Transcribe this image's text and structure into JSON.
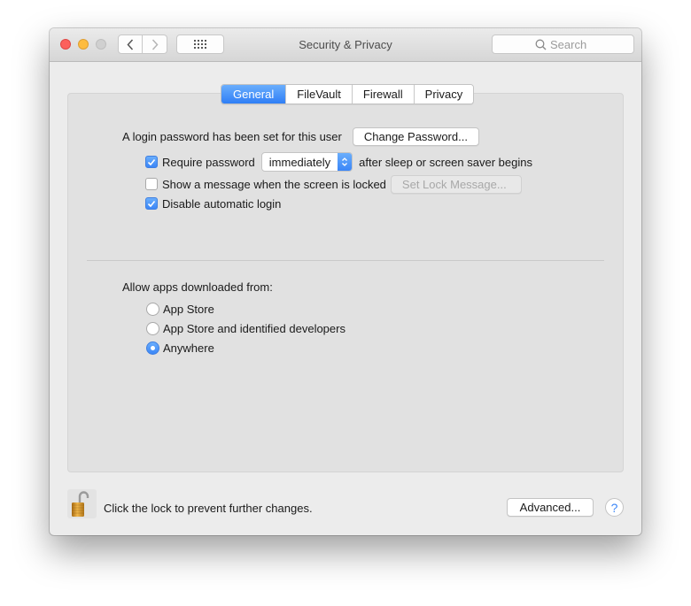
{
  "window": {
    "title": "Security & Privacy",
    "search_placeholder": "Search"
  },
  "tabs": [
    {
      "label": "General",
      "active": true
    },
    {
      "label": "FileVault",
      "active": false
    },
    {
      "label": "Firewall",
      "active": false
    },
    {
      "label": "Privacy",
      "active": false
    }
  ],
  "general": {
    "login_password_text": "A login password has been set for this user",
    "change_password_label": "Change Password...",
    "require_password": {
      "label": "Require password",
      "checked": true,
      "delay_value": "immediately",
      "suffix": "after sleep or screen saver begins"
    },
    "show_message": {
      "label": "Show a message when the screen is locked",
      "checked": false,
      "button_label": "Set Lock Message...",
      "button_enabled": false
    },
    "disable_auto_login": {
      "label": "Disable automatic login",
      "checked": true
    },
    "allow_apps": {
      "heading": "Allow apps downloaded from:",
      "options": [
        {
          "label": "App Store",
          "selected": false
        },
        {
          "label": "App Store and identified developers",
          "selected": false
        },
        {
          "label": "Anywhere",
          "selected": true
        }
      ]
    }
  },
  "footer": {
    "lock_state": "unlocked",
    "lock_text": "Click the lock to prevent further changes.",
    "advanced_label": "Advanced...",
    "help_label": "?"
  },
  "colors": {
    "accent": "#3b86f7",
    "close": "#fc605c",
    "minimize": "#fdbc40",
    "zoom_disabled": "#d0d0d0"
  }
}
